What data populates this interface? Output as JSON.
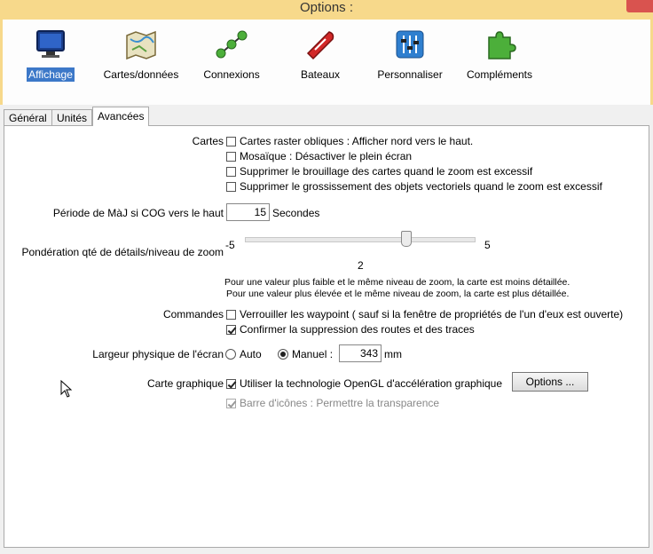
{
  "window": {
    "title": "Options :"
  },
  "toolbar": {
    "items": [
      {
        "label": "Affichage",
        "icon": "monitor-icon",
        "active": true
      },
      {
        "label": "Cartes/données",
        "icon": "map-icon"
      },
      {
        "label": "Connexions",
        "icon": "network-icon"
      },
      {
        "label": "Bateaux",
        "icon": "boat-icon"
      },
      {
        "label": "Personnaliser",
        "icon": "sliders-icon"
      },
      {
        "label": "Compléments",
        "icon": "puzzle-icon"
      }
    ]
  },
  "tabs": [
    {
      "label": "Général"
    },
    {
      "label": "Unités"
    },
    {
      "label": "Avancées",
      "active": true
    }
  ],
  "cartes": {
    "label": "Cartes",
    "options": [
      {
        "label": "Cartes raster obliques : Afficher nord vers le haut.",
        "checked": false
      },
      {
        "label": "Mosaïque : Désactiver le plein écran",
        "checked": false
      },
      {
        "label": "Supprimer le brouillage des cartes quand le zoom est excessif",
        "checked": false
      },
      {
        "label": "Supprimer le grossissement des objets vectoriels quand le zoom est excessif",
        "checked": false
      }
    ]
  },
  "cog": {
    "label": "Période de MàJ si COG vers le haut",
    "value": "15",
    "unit": "Secondes"
  },
  "zoom_detail": {
    "label": "Pondération qté de détails/niveau de zoom",
    "min_label": "-5",
    "max_label": "5",
    "value_label": "2",
    "min": -5,
    "max": 5,
    "value": 2,
    "note_line1": "Pour une valeur plus faible et le même niveau de zoom, la carte est moins détaillée.",
    "note_line2": "Pour une valeur plus élevée et le même niveau de zoom, la carte est plus détaillée."
  },
  "commandes": {
    "label": "Commandes",
    "options": [
      {
        "label": "Verrouiller les waypoint ( sauf si la fenêtre de propriétés de l'un d'eux est ouverte)",
        "checked": false
      },
      {
        "label": "Confirmer la suppression des routes et des traces",
        "checked": true
      }
    ]
  },
  "screen_width": {
    "label": "Largeur physique de l'écran",
    "auto_label": "Auto",
    "manual_label": "Manuel :",
    "selected": "manual",
    "value": "343",
    "unit": "mm"
  },
  "graphics": {
    "label": "Carte graphique",
    "opengl_label": "Utiliser la technologie OpenGL d'accélération graphique",
    "opengl_checked": true,
    "options_button": "Options ...",
    "toolbar_transparency_label": "Barre d'icônes : Permettre la transparence",
    "toolbar_transparency_checked": true
  },
  "colors": {
    "title_bar": "#f7d98b",
    "active_selection": "#3c78c8",
    "close_button": "#d9534f"
  }
}
